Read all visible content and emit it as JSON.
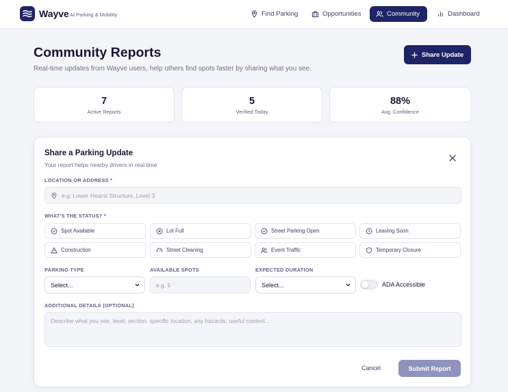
{
  "header": {
    "brand": "Wayve",
    "tagline": "AI Parking & Mobility",
    "nav": [
      {
        "label": "Find Parking",
        "icon": "map-pin-icon"
      },
      {
        "label": "Opportunities",
        "icon": "briefcase-icon"
      },
      {
        "label": "Community",
        "icon": "users-icon",
        "active": true
      },
      {
        "label": "Dashboard",
        "icon": "bar-chart-icon"
      }
    ]
  },
  "page": {
    "title": "Community Reports",
    "subtitle": "Real-time updates from Wayve users, help others find spots faster by sharing what you see.",
    "share_button": "Share Update"
  },
  "stats": [
    {
      "value": "7",
      "label": "Active Reports"
    },
    {
      "value": "5",
      "label": "Verified Today"
    },
    {
      "value": "88%",
      "label": "Avg. Confidence"
    }
  ],
  "form": {
    "title": "Share a Parking Update",
    "subtitle": "Your report helps nearby drivers in real time",
    "location_label": "LOCATION OR ADDRESS *",
    "location_placeholder": "e.g. Lower Hearst Structure, Level 3",
    "status_label": "WHAT'S THE STATUS? *",
    "statuses": [
      {
        "label": "Spot Available",
        "icon": "check-circle-icon"
      },
      {
        "label": "Lot Full",
        "icon": "x-circle-icon"
      },
      {
        "label": "Street Parking Open",
        "icon": "check-circle-icon"
      },
      {
        "label": "Leaving Soon",
        "icon": "clock-icon"
      },
      {
        "label": "Construction",
        "icon": "warning-triangle-icon"
      },
      {
        "label": "Street Cleaning",
        "icon": "gauge-icon"
      },
      {
        "label": "Event Traffic",
        "icon": "users-icon"
      },
      {
        "label": "Temporary Closure",
        "icon": "shield-icon"
      }
    ],
    "parking_type_label": "PARKING TYPE",
    "parking_type_value": "Select...",
    "spots_label": "AVAILABLE SPOTS",
    "spots_placeholder": "e.g. 5",
    "duration_label": "EXPECTED DURATION",
    "duration_value": "Select...",
    "ada_label": "ADA Accessible",
    "ada_on": false,
    "details_label": "ADDITIONAL DETAILS (OPTIONAL)",
    "details_placeholder": "Describe what you see, level, section, specific location, any hazards, useful context...",
    "cancel": "Cancel",
    "submit": "Submit Report"
  },
  "colors": {
    "brand": "#1e2466",
    "submit_disabled": "#8f93bd",
    "background": "#f4f5f8"
  }
}
